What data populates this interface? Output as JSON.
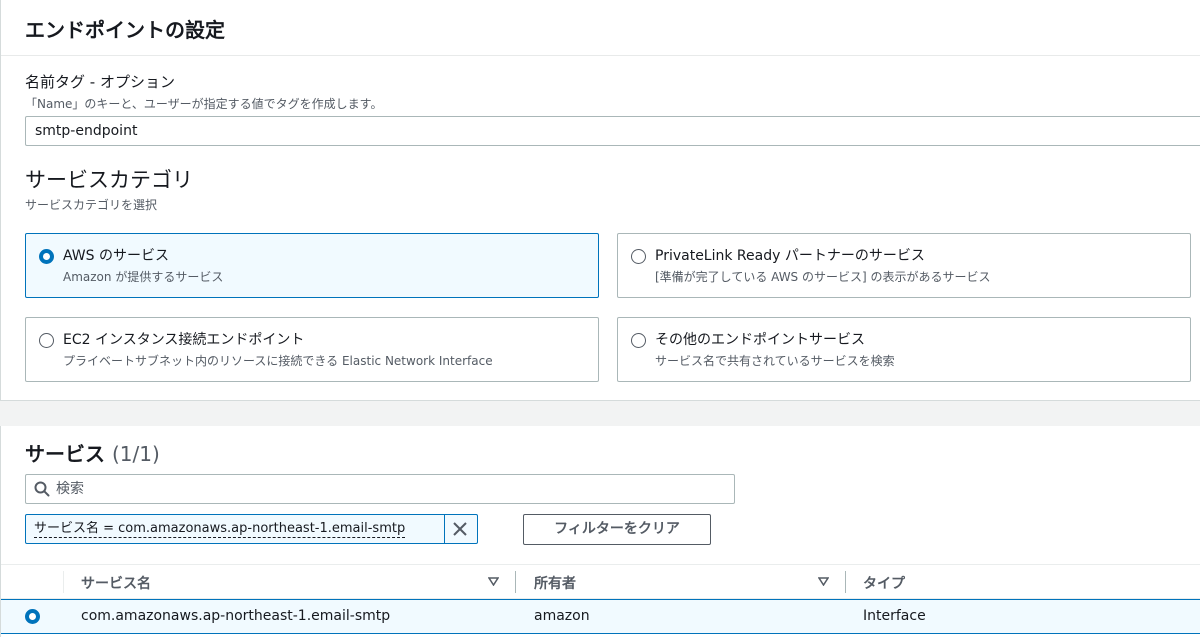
{
  "endpoint_settings": {
    "title": "エンドポイントの設定",
    "name_tag": {
      "label": "名前タグ - オプション",
      "description": "「Name」のキーと、ユーザーが指定する値でタグを作成します。",
      "value": "smtp-endpoint"
    },
    "service_category": {
      "title": "サービスカテゴリ",
      "description": "サービスカテゴリを選択",
      "options": [
        {
          "title": "AWS のサービス",
          "description": "Amazon が提供するサービス",
          "selected": true
        },
        {
          "title": "PrivateLink Ready パートナーのサービス",
          "description": "[準備が完了している AWS のサービス] の表示があるサービス",
          "selected": false
        },
        {
          "title": "EC2 インスタンス接続エンドポイント",
          "description": "プライベートサブネット内のリソースに接続できる Elastic Network Interface",
          "selected": false
        },
        {
          "title": "その他のエンドポイントサービス",
          "description": "サービス名で共有されているサービスを検索",
          "selected": false
        }
      ]
    }
  },
  "services": {
    "title": "サービス",
    "count": "(1/1)",
    "search_placeholder": "検索",
    "filter_token": "サービス名 = com.amazonaws.ap-northeast-1.email-smtp",
    "clear_filters_label": "フィルターをクリア",
    "columns": [
      "サービス名",
      "所有者",
      "タイプ"
    ],
    "rows": [
      {
        "service_name": "com.amazonaws.ap-northeast-1.email-smtp",
        "owner": "amazon",
        "type": "Interface",
        "selected": true
      }
    ]
  },
  "colors": {
    "accent": "#0073bb",
    "selected_bg": "#f1faff",
    "text": "#16191f",
    "secondary_text": "#545b64",
    "border": "#aab7b8",
    "page_bg": "#f2f3f3"
  }
}
